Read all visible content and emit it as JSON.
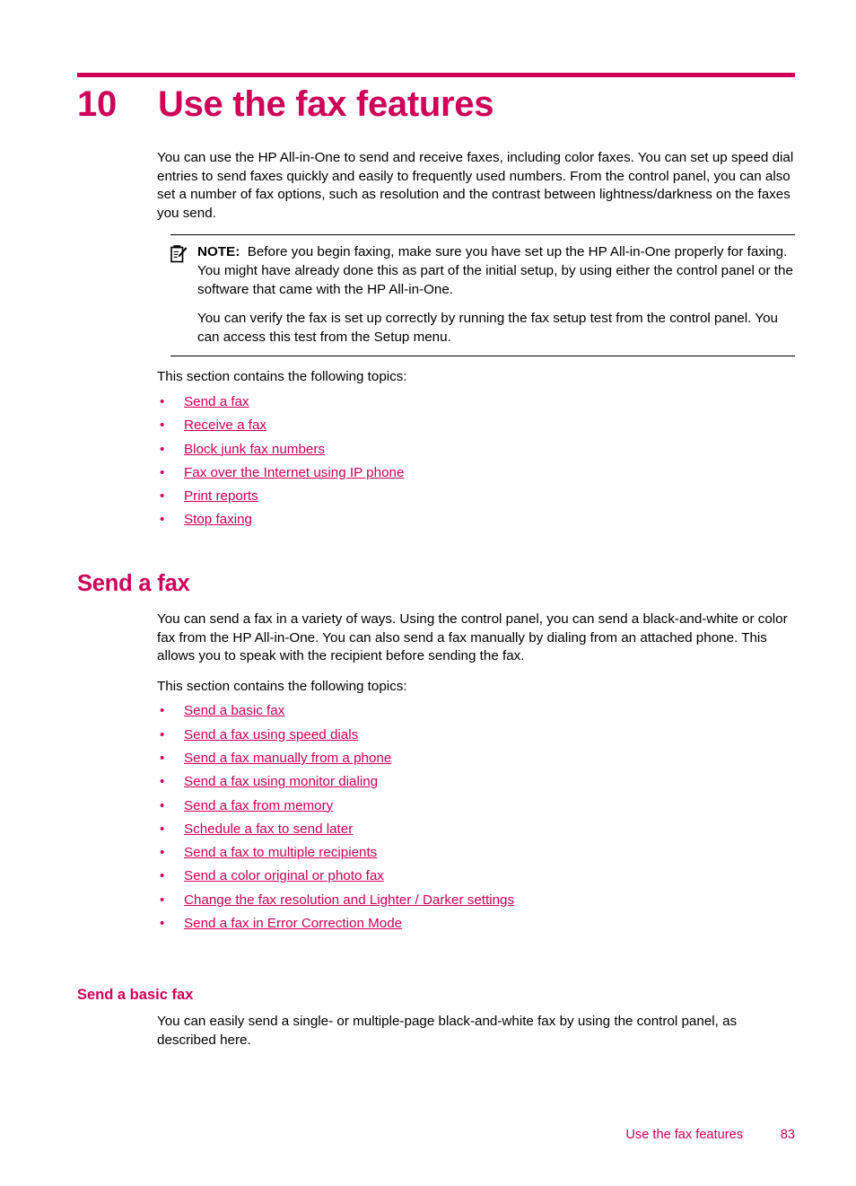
{
  "colors": {
    "accent": "#CE0058",
    "text": "#000000",
    "background": "#FFFFFF"
  },
  "chapter": {
    "number": "10",
    "title": "Use the fax features"
  },
  "intro": {
    "paragraph": "You can use the HP All-in-One to send and receive faxes, including color faxes. You can set up speed dial entries to send faxes quickly and easily to frequently used numbers. From the control panel, you can also set a number of fax options, such as resolution and the contrast between lightness/darkness on the faxes you send."
  },
  "note": {
    "icon": "note-clipboard-pencil-icon",
    "label": "NOTE:",
    "text": "Before you begin faxing, make sure you have set up the HP All-in-One properly for faxing. You might have already done this as part of the initial setup, by using either the control panel or the software that came with the HP All-in-One.",
    "second_paragraph": "You can verify the fax is set up correctly by running the fax setup test from the control panel. You can access this test from the Setup menu."
  },
  "topics_intro": "This section contains the following topics:",
  "chapter_topics": [
    "Send a fax",
    "Receive a fax",
    "Block junk fax numbers",
    "Fax over the Internet using IP phone",
    "Print reports",
    "Stop faxing"
  ],
  "send_a_fax": {
    "heading": "Send a fax",
    "paragraph": "You can send a fax in a variety of ways. Using the control panel, you can send a black-and-white or color fax from the HP All-in-One. You can also send a fax manually by dialing from an attached phone. This allows you to speak with the recipient before sending the fax.",
    "topics_intro": "This section contains the following topics:",
    "topics": [
      "Send a basic fax",
      "Send a fax using speed dials",
      "Send a fax manually from a phone",
      "Send a fax using monitor dialing",
      "Send a fax from memory",
      "Schedule a fax to send later",
      "Send a fax to multiple recipients",
      "Send a color original or photo fax",
      "Change the fax resolution and Lighter / Darker settings",
      "Send a fax in Error Correction Mode"
    ]
  },
  "send_a_basic_fax": {
    "heading": "Send a basic fax",
    "paragraph": "You can easily send a single- or multiple-page black-and-white fax by using the control panel, as described here."
  },
  "footer": {
    "title": "Use the fax features",
    "page": "83"
  },
  "bullet_glyph": "•"
}
